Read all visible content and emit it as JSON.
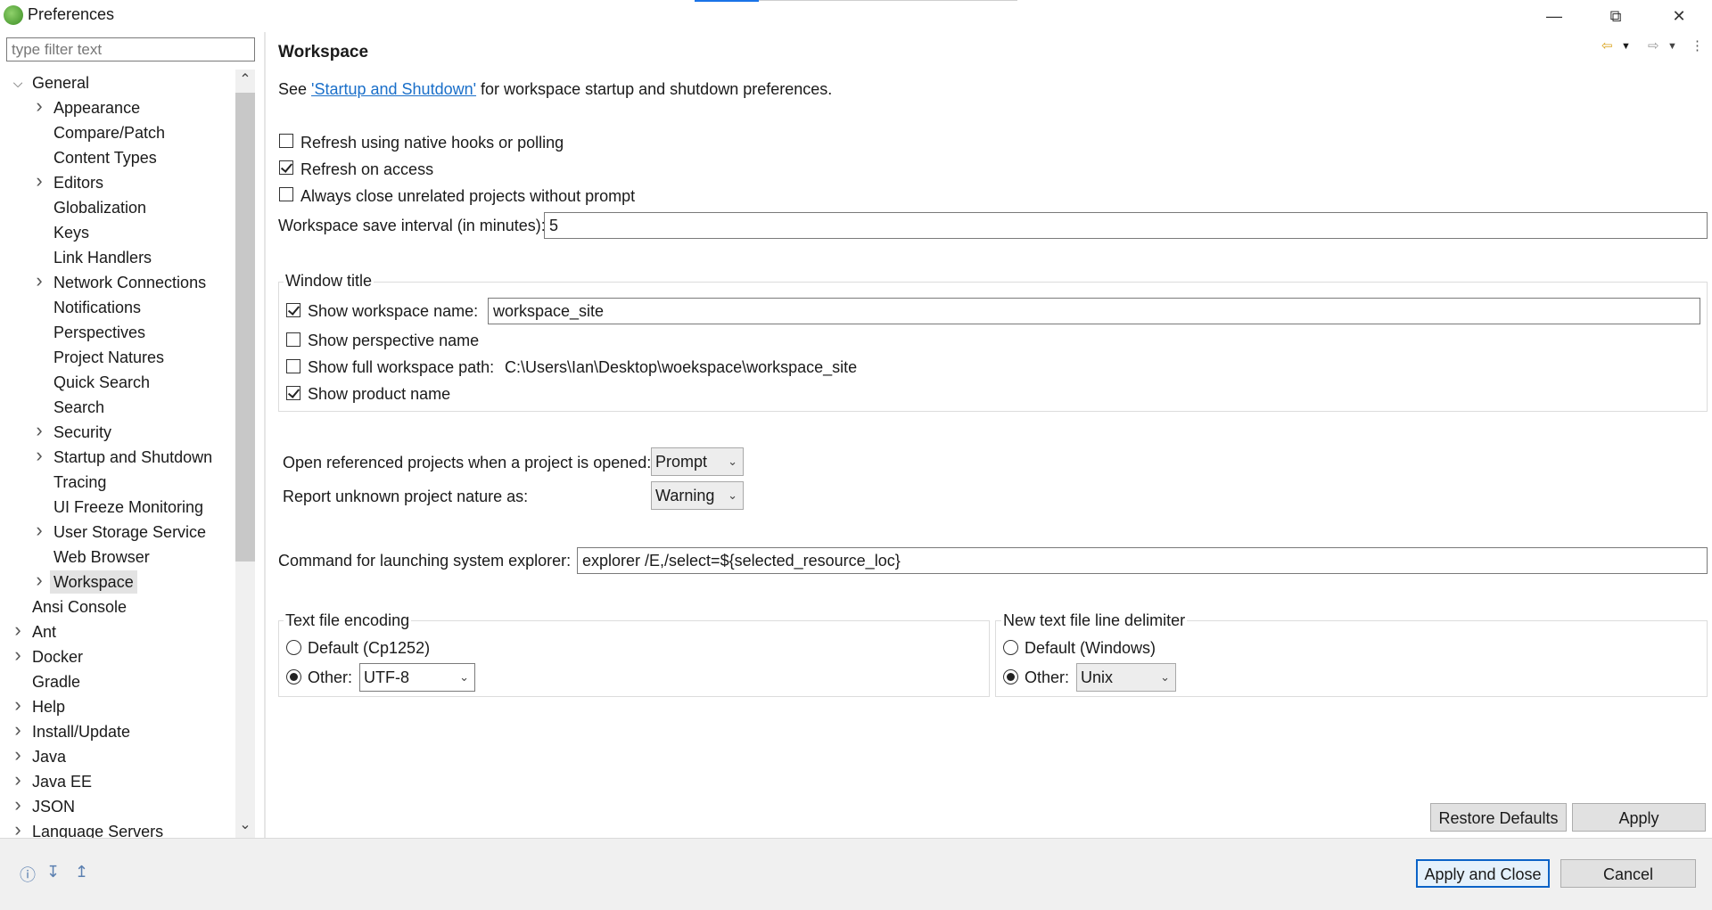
{
  "window": {
    "title": "Preferences",
    "minimize_icon": "minimize-icon",
    "restore_icon": "restore-icon",
    "close_icon": "close-icon"
  },
  "sidebar": {
    "filter_placeholder": "type filter text",
    "tree": [
      {
        "label": "General",
        "level": 0,
        "expander": "expanded"
      },
      {
        "label": "Appearance",
        "level": 1,
        "expander": "collapsed"
      },
      {
        "label": "Compare/Patch",
        "level": 1,
        "expander": "none"
      },
      {
        "label": "Content Types",
        "level": 1,
        "expander": "none"
      },
      {
        "label": "Editors",
        "level": 1,
        "expander": "collapsed"
      },
      {
        "label": "Globalization",
        "level": 1,
        "expander": "none"
      },
      {
        "label": "Keys",
        "level": 1,
        "expander": "none"
      },
      {
        "label": "Link Handlers",
        "level": 1,
        "expander": "none"
      },
      {
        "label": "Network Connections",
        "level": 1,
        "expander": "collapsed"
      },
      {
        "label": "Notifications",
        "level": 1,
        "expander": "none"
      },
      {
        "label": "Perspectives",
        "level": 1,
        "expander": "none"
      },
      {
        "label": "Project Natures",
        "level": 1,
        "expander": "none"
      },
      {
        "label": "Quick Search",
        "level": 1,
        "expander": "none"
      },
      {
        "label": "Search",
        "level": 1,
        "expander": "none"
      },
      {
        "label": "Security",
        "level": 1,
        "expander": "collapsed"
      },
      {
        "label": "Startup and Shutdown",
        "level": 1,
        "expander": "collapsed"
      },
      {
        "label": "Tracing",
        "level": 1,
        "expander": "none"
      },
      {
        "label": "UI Freeze Monitoring",
        "level": 1,
        "expander": "none"
      },
      {
        "label": "User Storage Service",
        "level": 1,
        "expander": "collapsed"
      },
      {
        "label": "Web Browser",
        "level": 1,
        "expander": "none"
      },
      {
        "label": "Workspace",
        "level": 1,
        "expander": "collapsed",
        "selected": true
      },
      {
        "label": "Ansi Console",
        "level": 0,
        "expander": "none"
      },
      {
        "label": "Ant",
        "level": 0,
        "expander": "collapsed"
      },
      {
        "label": "Docker",
        "level": 0,
        "expander": "collapsed"
      },
      {
        "label": "Gradle",
        "level": 0,
        "expander": "none"
      },
      {
        "label": "Help",
        "level": 0,
        "expander": "collapsed"
      },
      {
        "label": "Install/Update",
        "level": 0,
        "expander": "collapsed"
      },
      {
        "label": "Java",
        "level": 0,
        "expander": "collapsed"
      },
      {
        "label": "Java EE",
        "level": 0,
        "expander": "collapsed"
      },
      {
        "label": "JSON",
        "level": 0,
        "expander": "collapsed"
      },
      {
        "label": "Language Servers",
        "level": 0,
        "expander": "collapsed"
      }
    ]
  },
  "page": {
    "title": "Workspace",
    "intro_prefix": "See ",
    "intro_link": "'Startup and Shutdown'",
    "intro_suffix": " for workspace startup and shutdown preferences.",
    "refresh_native": {
      "label": "Refresh using native hooks or polling",
      "checked": false
    },
    "refresh_access": {
      "label": "Refresh on access",
      "checked": true
    },
    "close_unrelated": {
      "label": "Always close unrelated projects without prompt",
      "checked": false
    },
    "save_interval_label": "Workspace save interval (in minutes):",
    "save_interval_value": "5",
    "window_title": {
      "group_label": "Window title",
      "show_workspace_name": {
        "label": "Show workspace name:",
        "checked": true,
        "value": "workspace_site"
      },
      "show_perspective_name": {
        "label": "Show perspective name",
        "checked": false
      },
      "show_full_path": {
        "label": "Show full workspace path:",
        "checked": false,
        "value": "C:\\Users\\Ian\\Desktop\\woekspace\\workspace_site"
      },
      "show_product_name": {
        "label": "Show product name",
        "checked": true
      }
    },
    "open_referenced_label": "Open referenced projects when a project is opened:",
    "open_referenced_value": "Prompt",
    "report_nature_label": "Report unknown project nature as:",
    "report_nature_value": "Warning",
    "explorer_label": "Command for launching system explorer:",
    "explorer_value": "explorer /E,/select=${selected_resource_loc}",
    "encoding": {
      "group_label": "Text file encoding",
      "default_label": "Default (Cp1252)",
      "other_label": "Other:",
      "other_value": "UTF-8",
      "selected": "other"
    },
    "delimiter": {
      "group_label": "New text file line delimiter",
      "default_label": "Default (Windows)",
      "other_label": "Other:",
      "other_value": "Unix",
      "selected": "other"
    },
    "restore_defaults": "Restore Defaults",
    "apply": "Apply"
  },
  "footer": {
    "apply_close": "Apply and Close",
    "cancel": "Cancel",
    "icons": [
      "help-icon",
      "import-icon",
      "export-icon"
    ]
  }
}
